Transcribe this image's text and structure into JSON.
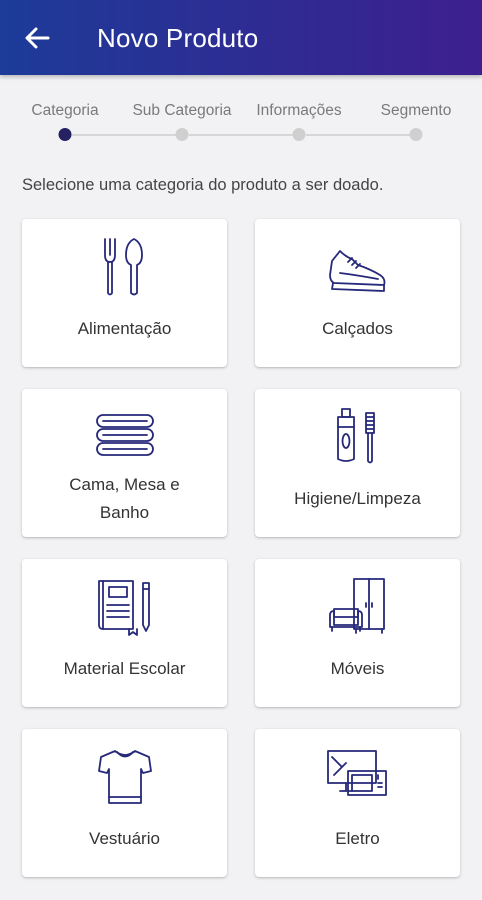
{
  "header": {
    "title": "Novo Produto"
  },
  "stepper": {
    "steps": [
      {
        "label": "Categoria",
        "active": true
      },
      {
        "label": "Sub Categoria",
        "active": false
      },
      {
        "label": "Informações",
        "active": false
      },
      {
        "label": "Segmento",
        "active": false
      }
    ]
  },
  "instruction": "Selecione uma categoria do produto a ser doado.",
  "categories": [
    {
      "label": "Alimentação",
      "icon": "cutlery-icon"
    },
    {
      "label": "Calçados",
      "icon": "sneaker-icon"
    },
    {
      "label": "Cama, Mesa e Banho",
      "label_line1": "Cama, Mesa e",
      "label_line2": "Banho",
      "icon": "towels-icon"
    },
    {
      "label": "Higiene/Limpeza",
      "icon": "toothpaste-brush-icon"
    },
    {
      "label": "Material Escolar",
      "icon": "notebook-pencil-icon"
    },
    {
      "label": "Móveis",
      "icon": "sofa-wardrobe-icon"
    },
    {
      "label": "Vestuário",
      "icon": "tshirt-icon"
    },
    {
      "label": "Eletro",
      "icon": "tv-microwave-icon"
    }
  ],
  "colors": {
    "appbar_start": "#1d3b98",
    "appbar_end": "#3d1f8f",
    "icon_stroke": "#26287a",
    "active_step": "#262262"
  }
}
